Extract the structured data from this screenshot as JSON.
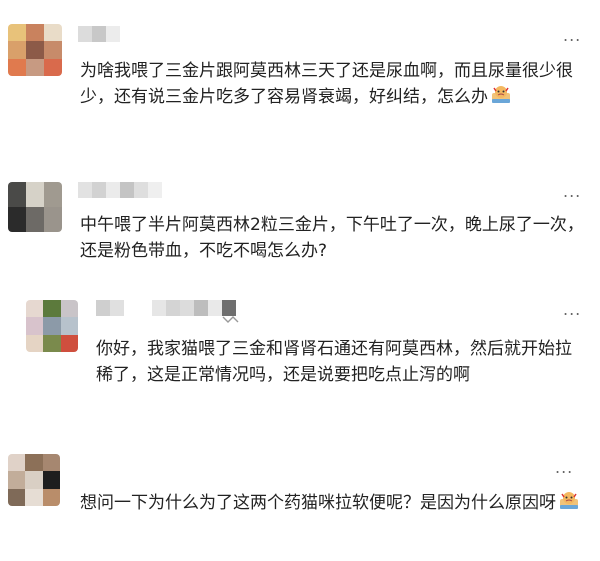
{
  "comments": [
    {
      "text": "为啥我喂了三金片跟阿莫西林三天了还是尿血啊，而且尿量很少很少，还有说三金片吃多了容易肾衰竭，好纠结，怎么办",
      "emoji": "crying-emoji-icon",
      "more": "..."
    },
    {
      "text": "中午喂了半片阿莫西林2粒三金片，下午吐了一次，晚上尿了一次，还是粉色带血，不吃不喝怎么办?",
      "more": "..."
    },
    {
      "text": "你好，我家猫喂了三金和肾肾石通还有阿莫西林，然后就开始拉稀了，这是正常情况吗，还是说要把吃点止泻的啊",
      "more": "...",
      "is_reply": true
    },
    {
      "text": "想问一下为什么为了这两个药猫咪拉软便呢？是因为什么原因呀",
      "emoji": "crying-emoji-icon",
      "more": "..."
    }
  ]
}
